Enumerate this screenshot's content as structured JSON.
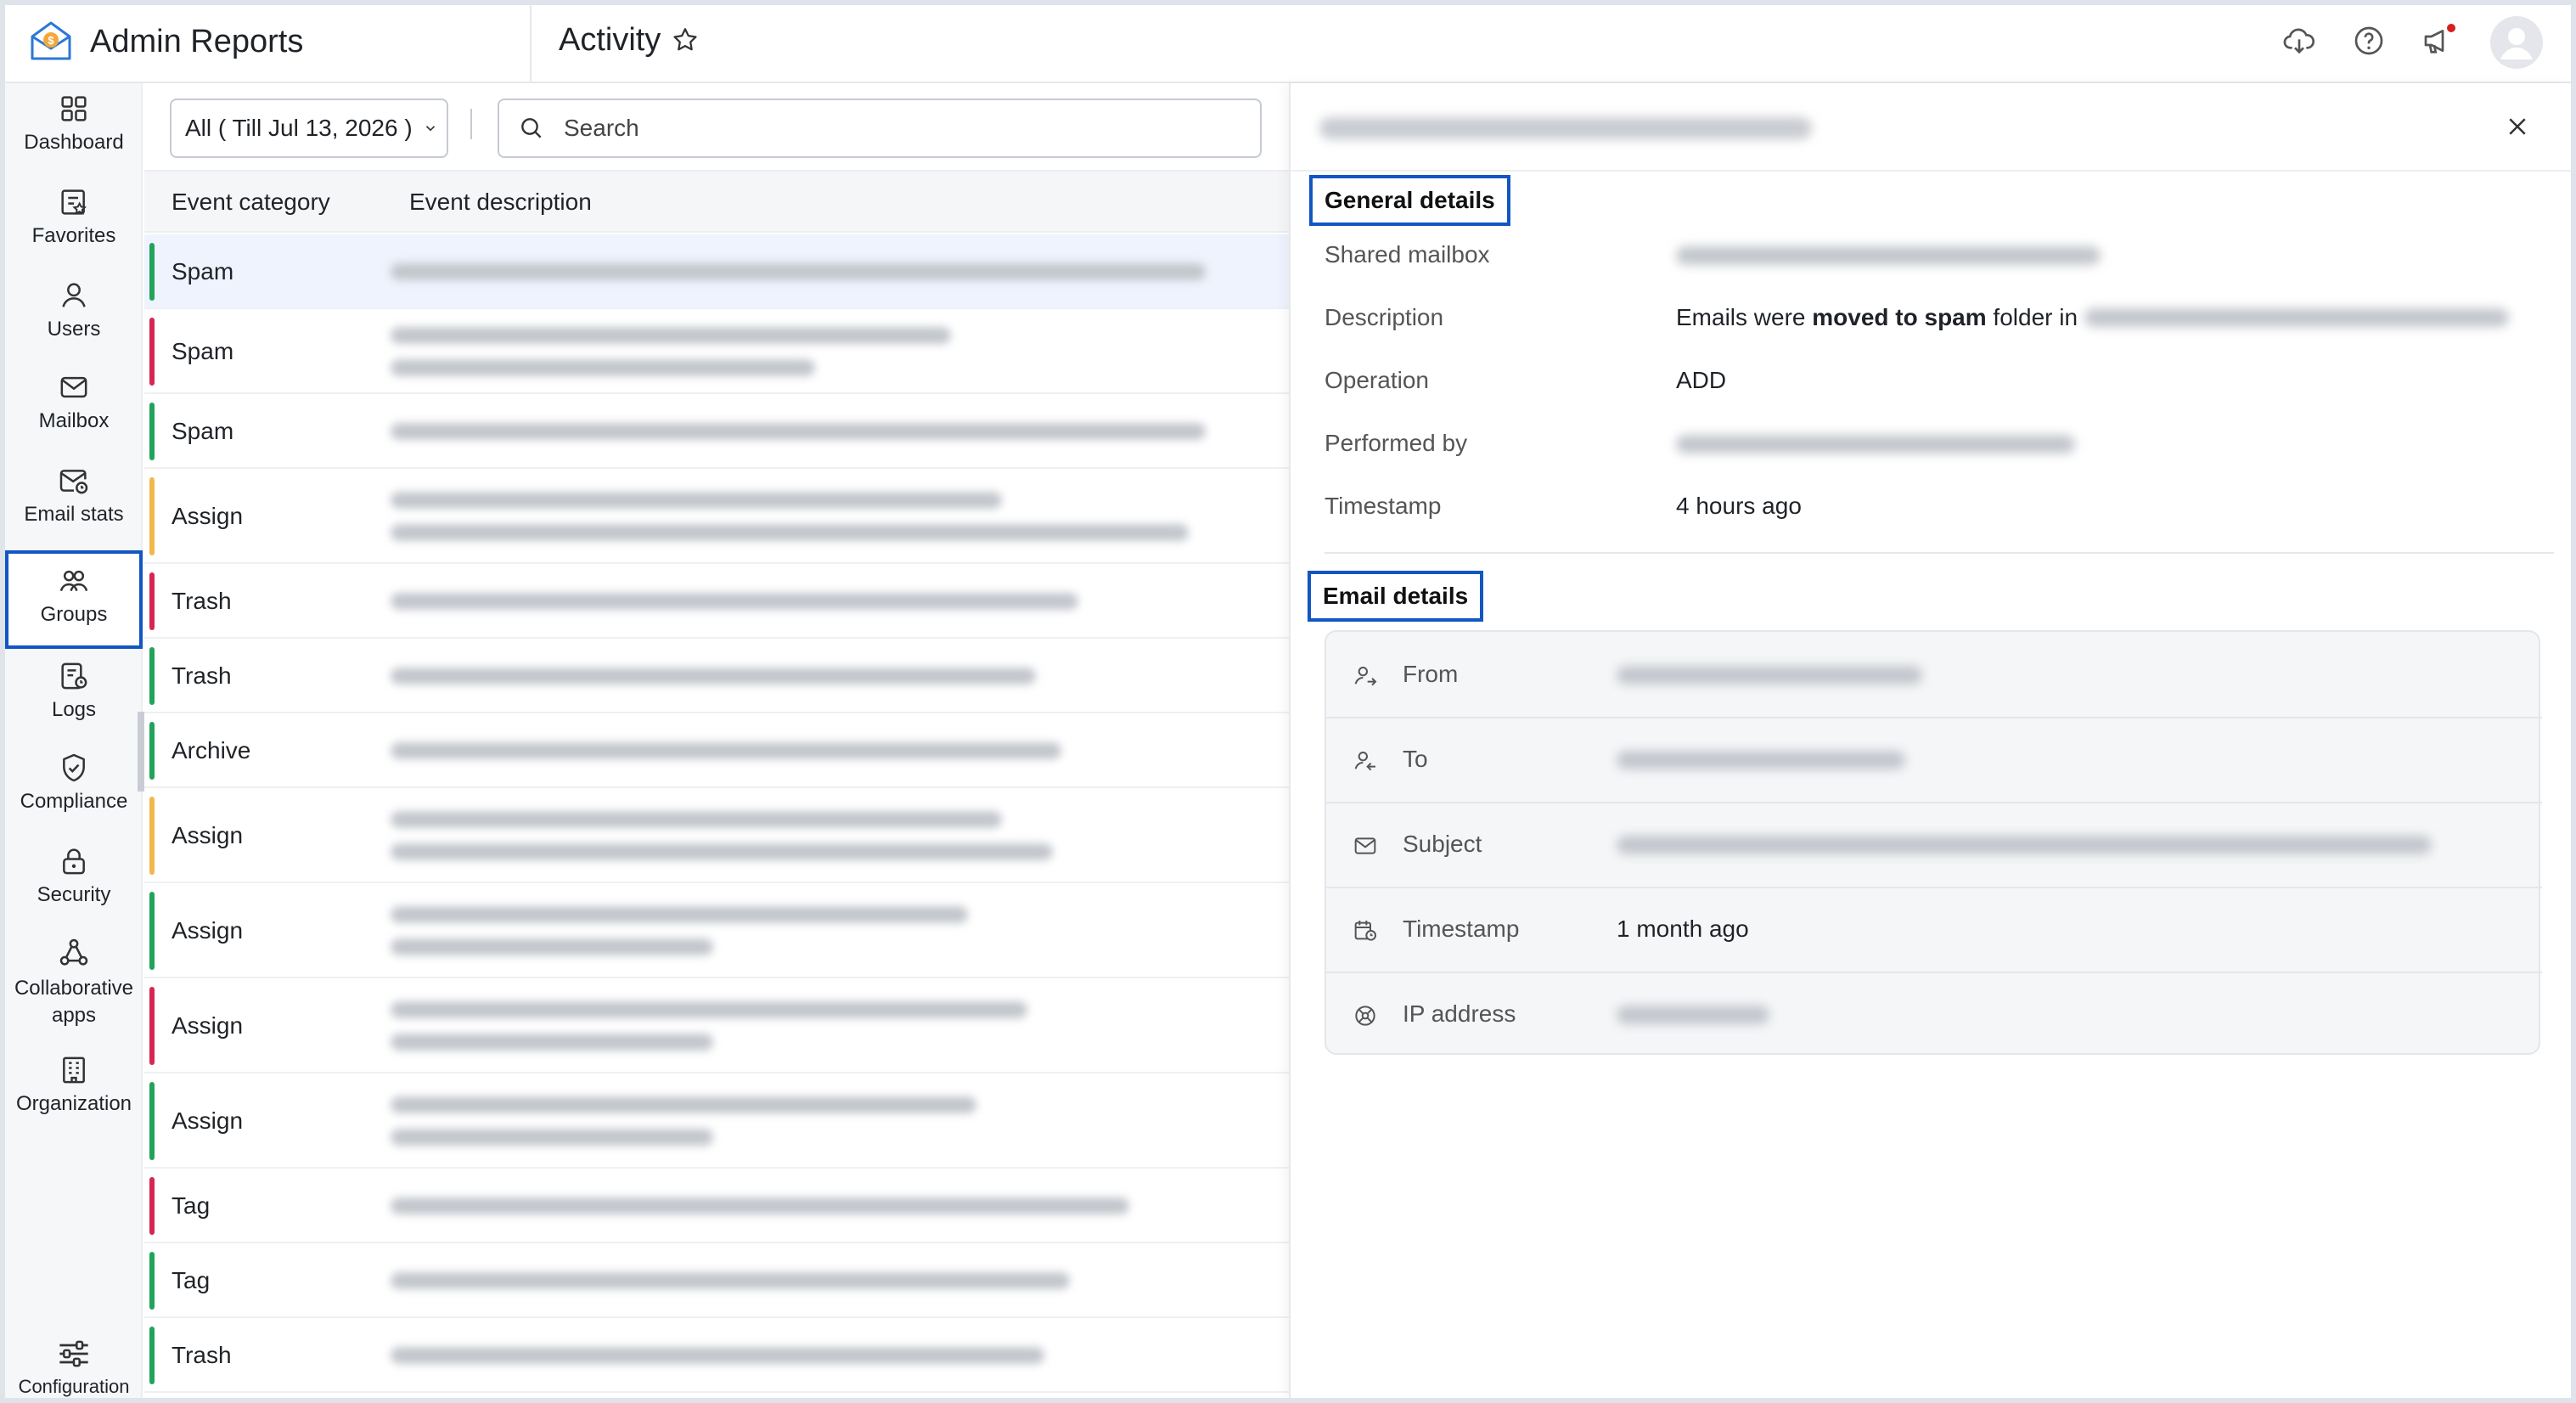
{
  "app": {
    "title": "Admin Reports"
  },
  "page": {
    "title": "Activity"
  },
  "sidebar": {
    "items": [
      {
        "label": "Dashboard"
      },
      {
        "label": "Favorites"
      },
      {
        "label": "Users"
      },
      {
        "label": "Mailbox"
      },
      {
        "label": "Email stats"
      },
      {
        "label": "Groups"
      },
      {
        "label": "Logs"
      },
      {
        "label": "Compliance"
      },
      {
        "label": "Security"
      },
      {
        "label": "Collaborative apps"
      },
      {
        "label": "Organization"
      },
      {
        "label": "Configuration"
      }
    ],
    "active": "Groups"
  },
  "filters": {
    "period_label": "All ( Till Jul 13, 2026 )",
    "search_placeholder": "Search"
  },
  "table": {
    "columns": [
      "Event category",
      "Event description"
    ],
    "rows": [
      {
        "category": "Spam",
        "color": "#22a35b"
      },
      {
        "category": "Spam",
        "color": "#d7264f"
      },
      {
        "category": "Spam",
        "color": "#22a35b"
      },
      {
        "category": "Assign",
        "color": "#f2b84b"
      },
      {
        "category": "Trash",
        "color": "#d7264f"
      },
      {
        "category": "Trash",
        "color": "#22a35b"
      },
      {
        "category": "Archive",
        "color": "#22a35b"
      },
      {
        "category": "Assign",
        "color": "#f2b84b"
      },
      {
        "category": "Assign",
        "color": "#22a35b"
      },
      {
        "category": "Assign",
        "color": "#d7264f"
      },
      {
        "category": "Assign",
        "color": "#22a35b"
      },
      {
        "category": "Tag",
        "color": "#d7264f"
      },
      {
        "category": "Tag",
        "color": "#22a35b"
      },
      {
        "category": "Trash",
        "color": "#22a35b"
      }
    ]
  },
  "details": {
    "general_title": "General details",
    "general": {
      "shared_mailbox_label": "Shared mailbox",
      "description_label": "Description",
      "description_prefix": "Emails were ",
      "description_bold": "moved to spam",
      "description_suffix": " folder in",
      "operation_label": "Operation",
      "operation_value": "ADD",
      "performed_by_label": "Performed by",
      "timestamp_label": "Timestamp",
      "timestamp_value": "4 hours ago"
    },
    "email_title": "Email details",
    "email": {
      "from_label": "From",
      "to_label": "To",
      "subject_label": "Subject",
      "timestamp_label": "Timestamp",
      "timestamp_value": "1 month ago",
      "ip_label": "IP address"
    }
  },
  "colors": {
    "accent": "#1256c4",
    "spam_green": "#22a35b",
    "red": "#d7264f",
    "amber": "#f2b84b",
    "notification_dot": "#d61f1f"
  },
  "icons": [
    "app-logo-icon",
    "star-icon",
    "cloud-download-icon",
    "help-icon",
    "announcement-icon",
    "avatar",
    "chevron-down-icon",
    "search-icon",
    "close-icon"
  ]
}
